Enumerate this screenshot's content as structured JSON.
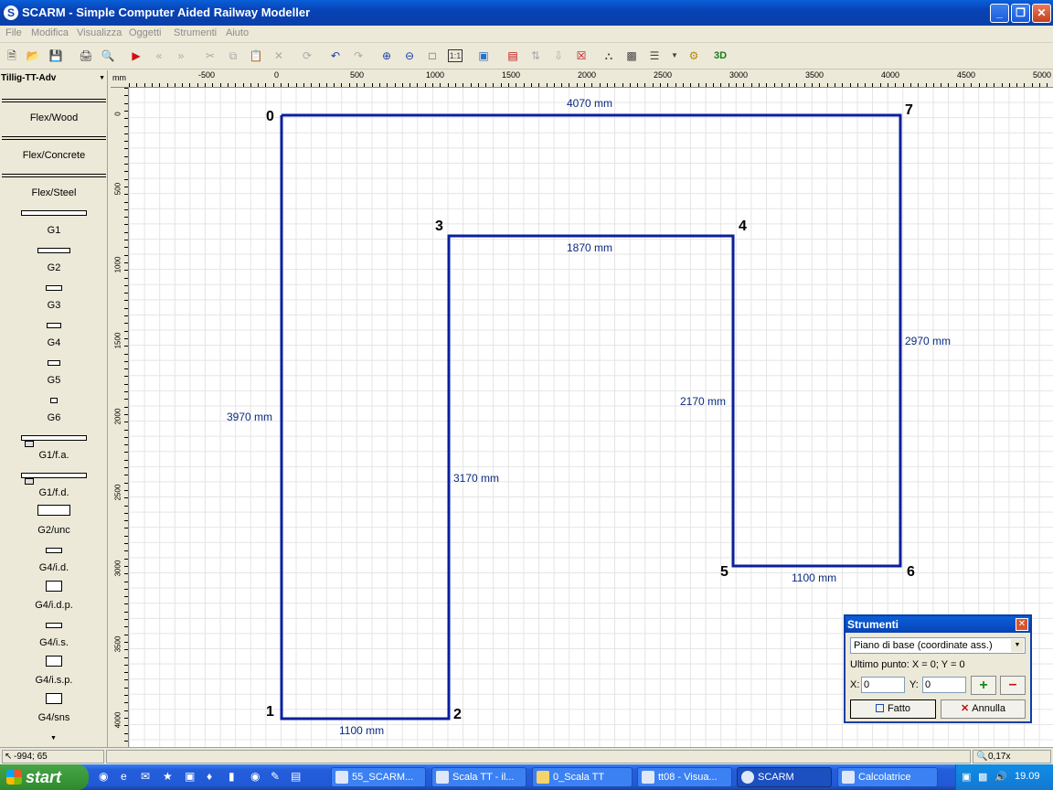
{
  "window": {
    "title": "SCARM - Simple Computer Aided Railway Modeller",
    "app_icon": "S",
    "minimize": "_",
    "maximize": "❐",
    "close": "✕"
  },
  "menu": [
    "File",
    "Modifica",
    "Visualizza",
    "Oggetti",
    "Strumenti",
    "Aiuto"
  ],
  "toolbar": {
    "icons": [
      "new-file-icon",
      "open-folder-icon",
      "save-icon",
      "print-icon",
      "print-preview-icon",
      "select-arrow-icon",
      "rewind-icon",
      "fast-forward-icon",
      "cut-icon",
      "copy-icon",
      "paste-icon",
      "delete-icon",
      "rotate-icon",
      "undo-icon",
      "redo-icon",
      "zoom-in-icon",
      "zoom-out-icon",
      "zoom-fit-icon",
      "zoom-1to1-icon",
      "background-image-icon",
      "track-icon",
      "flex-icon",
      "end-icon",
      "red-box-icon",
      "bridge-icon",
      "chip-icon",
      "layers-icon",
      "measure-icon",
      "3d-icon"
    ],
    "zoom_1to1_label": "1:1",
    "three_d_label": "3D"
  },
  "sidebar": {
    "library": "Tillig-TT-Adv",
    "items": [
      "Flex/Wood",
      "Flex/Concrete",
      "Flex/Steel",
      "G1",
      "G2",
      "G3",
      "G4",
      "G5",
      "G6",
      "G1/f.a.",
      "G1/f.d.",
      "G2/unc",
      "G4/i.d.",
      "G4/i.d.p.",
      "G4/i.s.",
      "G4/i.s.p.",
      "G4/sns"
    ]
  },
  "ruler": {
    "unit": "mm",
    "h_ticks": [
      "-500",
      "0",
      "500",
      "1000",
      "1500",
      "2000",
      "2500",
      "3000",
      "3500",
      "4000",
      "4500",
      "5000"
    ],
    "v_ticks": [
      "0",
      "500",
      "1000",
      "1500",
      "2000",
      "2500",
      "3000",
      "3500",
      "4000"
    ]
  },
  "drawing": {
    "points": [
      "0",
      "1",
      "2",
      "3",
      "4",
      "5",
      "6",
      "7"
    ],
    "dimensions": [
      "4070 mm",
      "3970 mm",
      "1100 mm",
      "3170 mm",
      "1870 mm",
      "2170 mm",
      "1100 mm",
      "2970 mm"
    ],
    "line_color": "#0a1f9c"
  },
  "tools_panel": {
    "title": "Strumenti",
    "mode": "Piano di base (coordinate ass.)",
    "last_point": "Ultimo punto: X = 0; Y = 0",
    "x_label": "X:",
    "x_value": "0",
    "y_label": "Y:",
    "y_value": "0",
    "done": "Fatto",
    "cancel": "Annulla"
  },
  "status": {
    "cursor": "-994; 65",
    "zoom": "0,17x"
  },
  "taskbar": {
    "start": "start",
    "tasks": [
      "55_SCARM...",
      "Scala TT - il...",
      "0_Scala TT",
      "tt08 - Visua...",
      "SCARM",
      "Calcolatrice"
    ],
    "clock": "19.09"
  }
}
